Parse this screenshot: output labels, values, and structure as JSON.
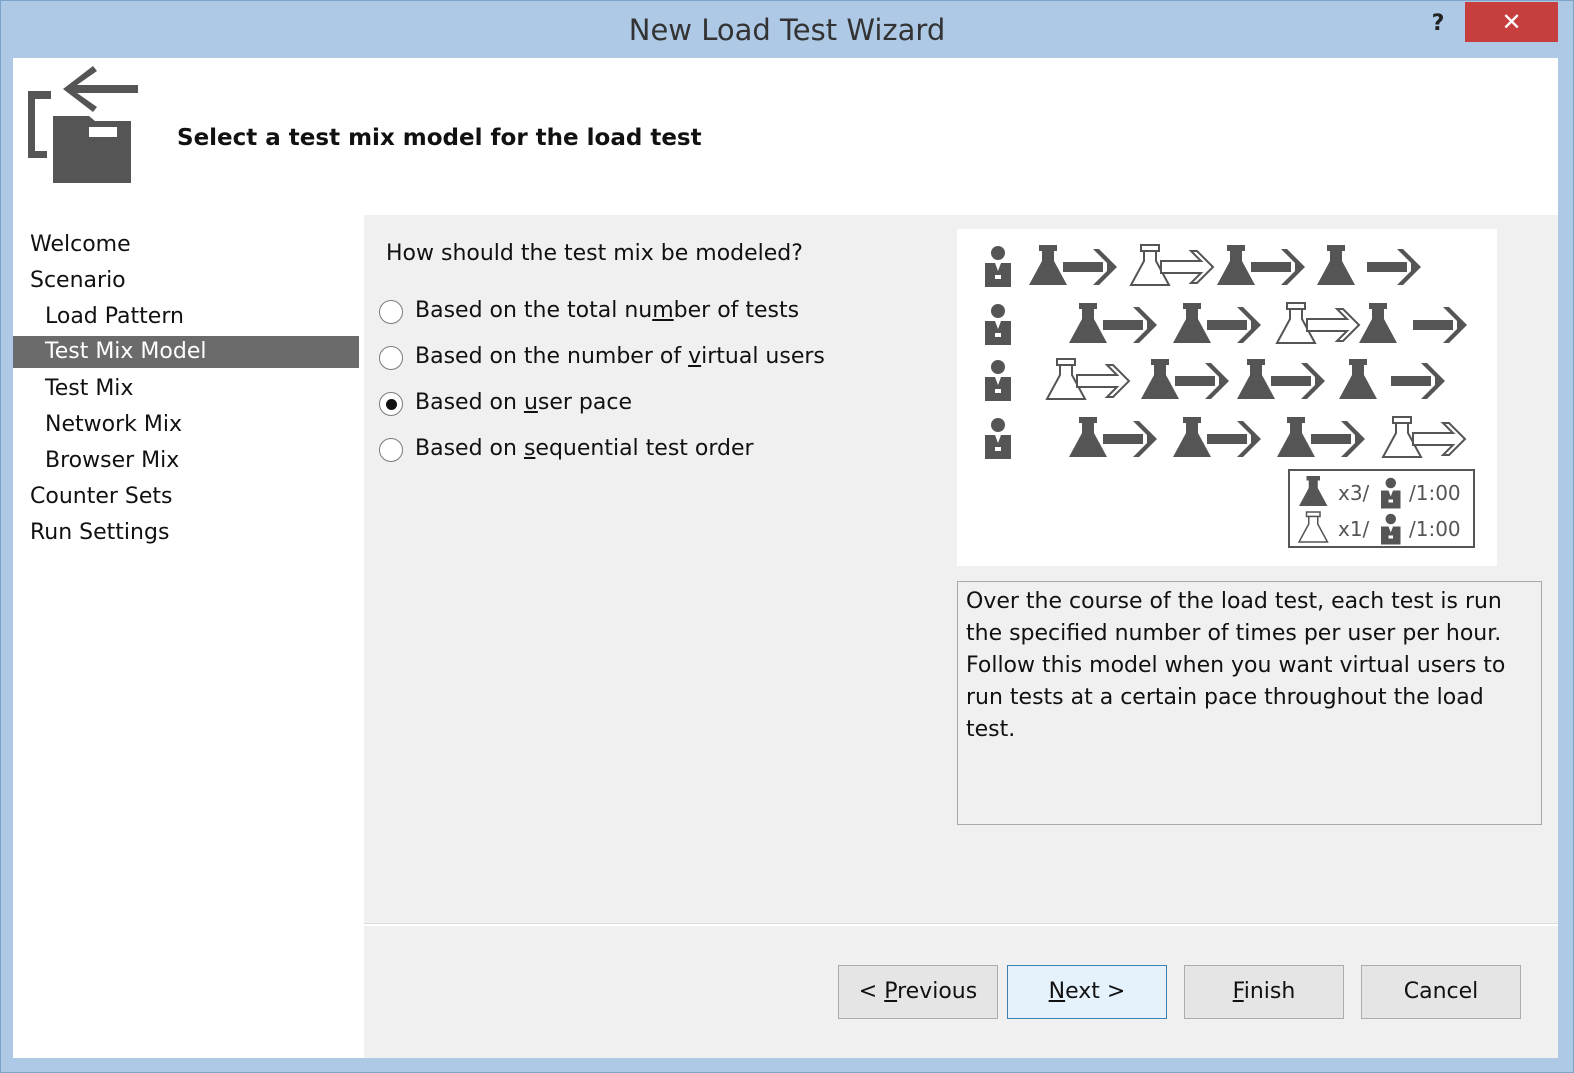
{
  "window": {
    "title": "New Load Test Wizard",
    "help_label": "?",
    "close_label": "✕"
  },
  "header": {
    "title": "Select a test mix model for the load test"
  },
  "nav": {
    "items": [
      {
        "label": "Welcome",
        "indent": 0,
        "selected": false
      },
      {
        "label": "Scenario",
        "indent": 0,
        "selected": false
      },
      {
        "label": "Load Pattern",
        "indent": 1,
        "selected": false
      },
      {
        "label": "Test Mix Model",
        "indent": 1,
        "selected": true
      },
      {
        "label": "Test Mix",
        "indent": 1,
        "selected": false
      },
      {
        "label": "Network Mix",
        "indent": 1,
        "selected": false
      },
      {
        "label": "Browser Mix",
        "indent": 1,
        "selected": false
      },
      {
        "label": "Counter Sets",
        "indent": 0,
        "selected": false
      },
      {
        "label": "Run Settings",
        "indent": 0,
        "selected": false
      }
    ]
  },
  "main": {
    "question": "How should the test mix be modeled?",
    "options": [
      {
        "pre": "Based on the total nu",
        "key": "m",
        "post": "ber of tests",
        "checked": false
      },
      {
        "pre": "Based on the number of ",
        "key": "v",
        "post": "irtual users",
        "checked": false
      },
      {
        "pre": "Based on ",
        "key": "u",
        "post": "ser pace",
        "checked": true
      },
      {
        "pre": "Based on ",
        "key": "s",
        "post": "equential test order",
        "checked": false
      }
    ],
    "legend": {
      "row1": "x3/",
      "row1_time": "/1:00",
      "row2": "x1/",
      "row2_time": "/1:00"
    },
    "description": "Over the course of the load test, each test is run the specified number of times per user per hour. Follow this model when you want virtual users to run tests at a certain pace throughout the load test."
  },
  "buttons": {
    "previous": {
      "pre": "< ",
      "key": "P",
      "post": "revious"
    },
    "next": {
      "pre": "",
      "key": "N",
      "post": "ext >"
    },
    "finish": {
      "pre": "",
      "key": "F",
      "post": "inish"
    },
    "cancel": {
      "pre": "Cancel",
      "key": "",
      "post": ""
    }
  },
  "colors": {
    "titlebar": "#adc9e6",
    "close": "#c73e3e",
    "nav_selected": "#6b6b6b",
    "icon_gray": "#555555"
  }
}
